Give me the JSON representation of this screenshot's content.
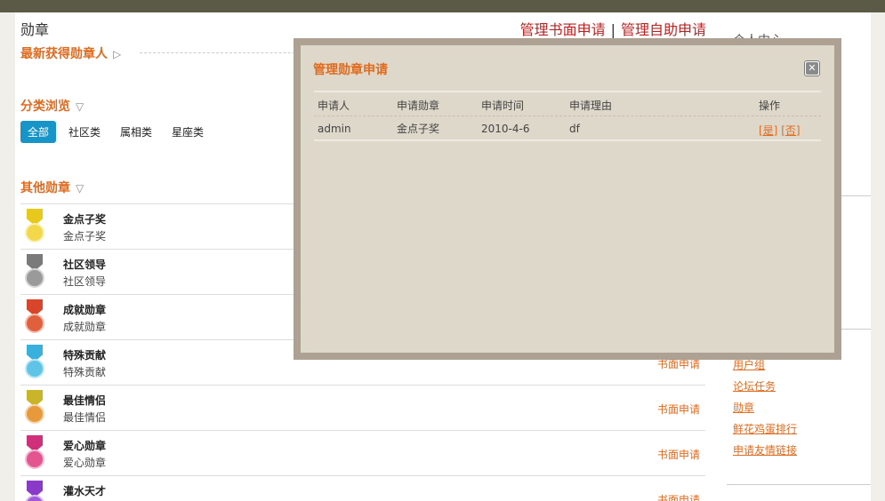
{
  "topbar": {
    "crumb": ""
  },
  "main": {
    "title": "勋章",
    "manage_written": "管理书面申请",
    "separator": "|",
    "manage_self": "管理自助申请",
    "latest_title": "最新获得勋章人",
    "latest_arrow": "▷",
    "browse_title": "分类浏览",
    "browse_arrow": "▽",
    "categories": [
      "全部",
      "社区类",
      "属相类",
      "星座类"
    ],
    "other_title": "其他勋章",
    "other_arrow": "▽",
    "badges": [
      {
        "name": "金点子奖",
        "desc": "金点子奖",
        "apply": "",
        "ribbon": "#e8c81a",
        "disk": "#f2d84a"
      },
      {
        "name": "社区领导",
        "desc": "社区领导",
        "apply": "",
        "ribbon": "#7a7a7a",
        "disk": "#9a9a9a"
      },
      {
        "name": "成就勋章",
        "desc": "成就勋章",
        "apply": "",
        "ribbon": "#d8452a",
        "disk": "#e0603e"
      },
      {
        "name": "特殊贡献",
        "desc": "特殊贡献",
        "apply": "书面申请",
        "ribbon": "#3ab0dc",
        "disk": "#5fc4e6"
      },
      {
        "name": "最佳情侣",
        "desc": "最佳情侣",
        "apply": "书面申请",
        "ribbon": "#c9b52a",
        "disk": "#e69a3c"
      },
      {
        "name": "爱心勋章",
        "desc": "爱心勋章",
        "apply": "书面申请",
        "ribbon": "#d0307a",
        "disk": "#e2558f"
      },
      {
        "name": "灌水天才",
        "desc": "灌水天才",
        "apply": "书面申请",
        "ribbon": "#8a3ac8",
        "disk": "#a25ad8"
      }
    ]
  },
  "sidebar": {
    "title": "个人中心",
    "links": [
      "用户组",
      "论坛任务",
      "勋章",
      "鲜花鸡蛋排行",
      "申请友情链接"
    ]
  },
  "dialog": {
    "title": "管理勋章申请",
    "close": "✕",
    "headers": [
      "申请人",
      "申请勋章",
      "申请时间",
      "申请理由",
      "操作"
    ],
    "row": {
      "applicant": "admin",
      "badge": "金点子奖",
      "date": "2010-4-6",
      "reason": "df",
      "yes": "[是]",
      "no": "[否]"
    }
  },
  "colors": {
    "accent": "#e06a1e",
    "link_red": "#b22222",
    "active_tab": "#1795c9",
    "dialog_bg": "#ded8cb"
  }
}
